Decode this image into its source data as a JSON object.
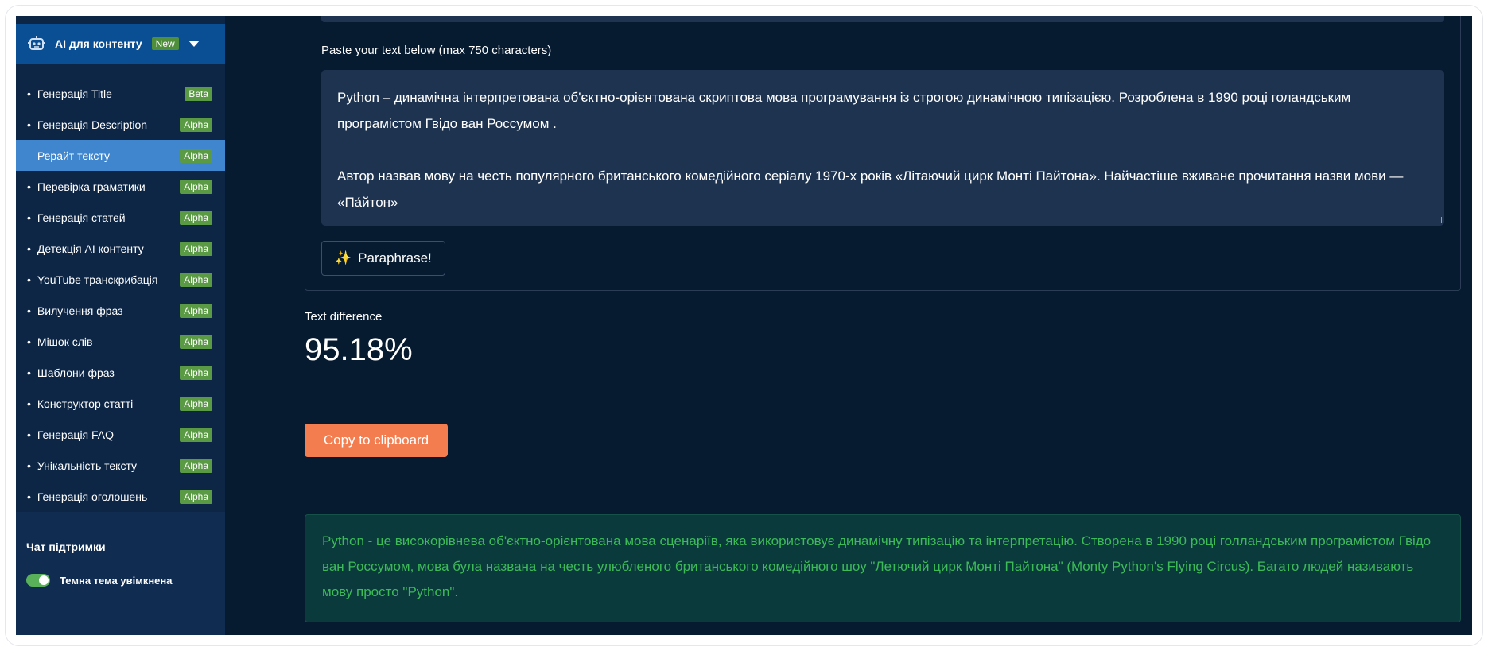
{
  "sidebar": {
    "title": "AI для контенту",
    "new_badge": "New",
    "items": [
      {
        "label": "Генерація Title",
        "badge": "Beta",
        "active": false
      },
      {
        "label": "Генерація Description",
        "badge": "Alpha",
        "active": false
      },
      {
        "label": "Рерайт тексту",
        "badge": "Alpha",
        "active": true
      },
      {
        "label": "Перевірка граматики",
        "badge": "Alpha",
        "active": false
      },
      {
        "label": "Генерація статей",
        "badge": "Alpha",
        "active": false
      },
      {
        "label": "Детекція AI контенту",
        "badge": "Alpha",
        "active": false
      },
      {
        "label": "YouTube транскрибація",
        "badge": "Alpha",
        "active": false
      },
      {
        "label": "Вилучення фраз",
        "badge": "Alpha",
        "active": false
      },
      {
        "label": "Мішок слів",
        "badge": "Alpha",
        "active": false
      },
      {
        "label": "Шаблони фраз",
        "badge": "Alpha",
        "active": false
      },
      {
        "label": "Конструктор статті",
        "badge": "Alpha",
        "active": false
      },
      {
        "label": "Генерація FAQ",
        "badge": "Alpha",
        "active": false
      },
      {
        "label": "Унікальність тексту",
        "badge": "Alpha",
        "active": false
      },
      {
        "label": "Генерація оголошень",
        "badge": "Alpha",
        "active": false
      }
    ],
    "support_title": "Чат підтримки",
    "theme_label": "Темна тема увімкнена",
    "theme_on": true
  },
  "main": {
    "paste_label": "Paste your text below (max 750 characters)",
    "input_paragraph_1": "Python  – динамічна інтерпретована об'єктно-орієнтована скриптова мова програмування із строгою динамічною типізацією. Розроблена в 1990 році голандським програмістом Гвідо ван Россумом .",
    "input_paragraph_2": "Автор назвав мову на честь популярного британського комедійного серіалу 1970-х років «Літаючий цирк Монті Пайтона». Найчастіше вживане прочитання назви мови — «Па́йтон»",
    "paraphrase_icon": "✨",
    "paraphrase_button": "Paraphrase!",
    "diff_label": "Text difference",
    "diff_value": "95.18%",
    "copy_button": "Copy to clipboard",
    "result_text": "Python - це високорівнева об'єктно-орієнтована мова сценаріїв, яка використовує динамічну типізацію та інтерпретацію. Створена в 1990 році голландським програмістом Гвідо ван Россумом, мова була названа на честь улюбленого британського комедійного шоу \"Летючий цирк Монті Пайтона\" (Monty Python's Flying Circus). Багато людей називають мову просто \"Python\"."
  },
  "colors": {
    "accent_active": "#3f86cf",
    "badge_green": "#5a9a44",
    "copy_button": "#f47d4f",
    "result_text": "#3dbb58"
  }
}
